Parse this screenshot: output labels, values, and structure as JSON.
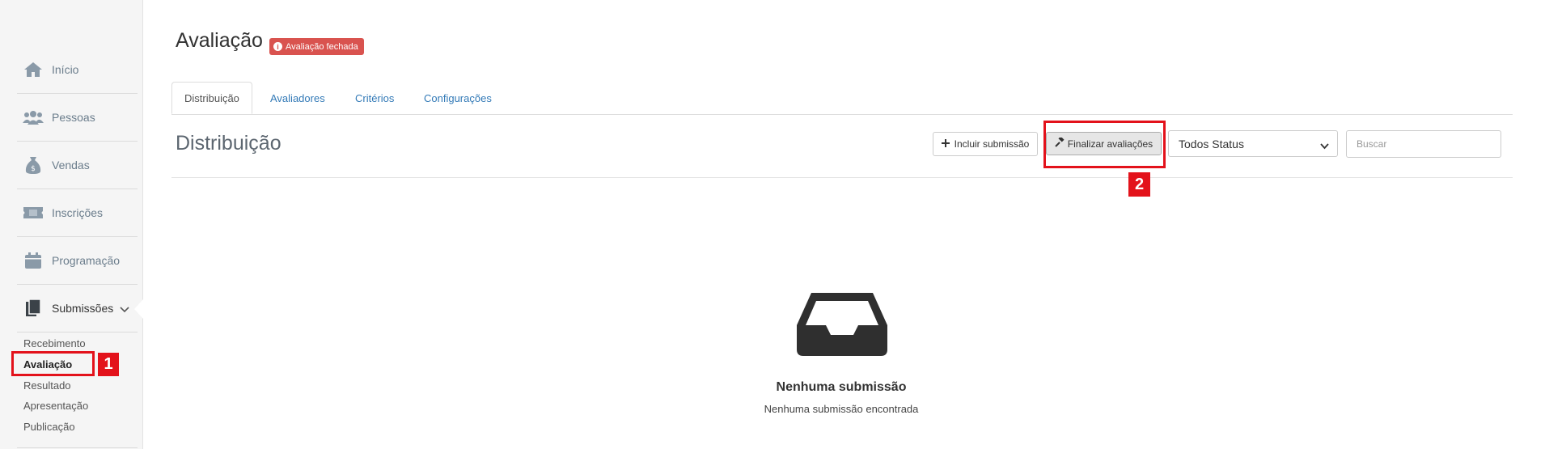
{
  "sidebar": {
    "items": [
      {
        "label": "Início",
        "icon": "home-icon"
      },
      {
        "label": "Pessoas",
        "icon": "people-icon"
      },
      {
        "label": "Vendas",
        "icon": "money-bag-icon"
      },
      {
        "label": "Inscrições",
        "icon": "ticket-icon"
      },
      {
        "label": "Programação",
        "icon": "calendar-icon"
      },
      {
        "label": "Submissões",
        "icon": "documents-icon"
      }
    ],
    "subitems": [
      "Recebimento",
      "Avaliação",
      "Resultado",
      "Apresentação",
      "Publicação"
    ]
  },
  "header": {
    "title": "Avaliação",
    "badge": "Avaliação fechada",
    "badge_color": "#d9534f"
  },
  "tabs": [
    "Distribuição",
    "Avaliadores",
    "Critérios",
    "Configurações"
  ],
  "section": {
    "title": "Distribuição",
    "include_button": "Incluir submissão",
    "finalize_button": "Finalizar avaliações",
    "status_select": "Todos Status",
    "search_placeholder": "Buscar"
  },
  "empty_state": {
    "icon": "inbox-icon",
    "title": "Nenhuma submissão",
    "subtitle": "Nenhuma submissão encontrada"
  },
  "annotations": [
    "1",
    "2"
  ],
  "colors": {
    "accent": "#337ab7",
    "annotation": "#e3121b"
  }
}
